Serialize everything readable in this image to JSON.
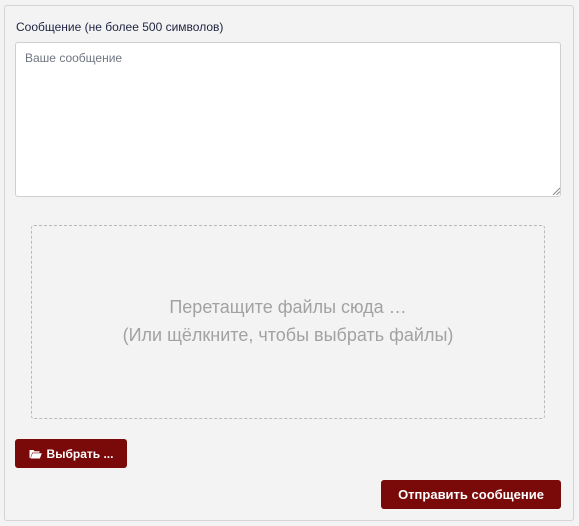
{
  "form": {
    "message_label": "Сообщение (не более 500 символов)",
    "message_placeholder": "Ваше сообщение",
    "message_value": ""
  },
  "dropzone": {
    "line1": "Перетащите файлы сюда …",
    "line2": "(Или щёлкните, чтобы выбрать файлы)"
  },
  "buttons": {
    "choose_label": "Выбрать ...",
    "choose_icon": "folder-open-icon",
    "send_label": "Отправить сообщение"
  },
  "colors": {
    "background": "#f3f3f3",
    "accent": "#7a0a0a",
    "label_text": "#1f2340",
    "dropzone_text": "#a2a2a2"
  }
}
